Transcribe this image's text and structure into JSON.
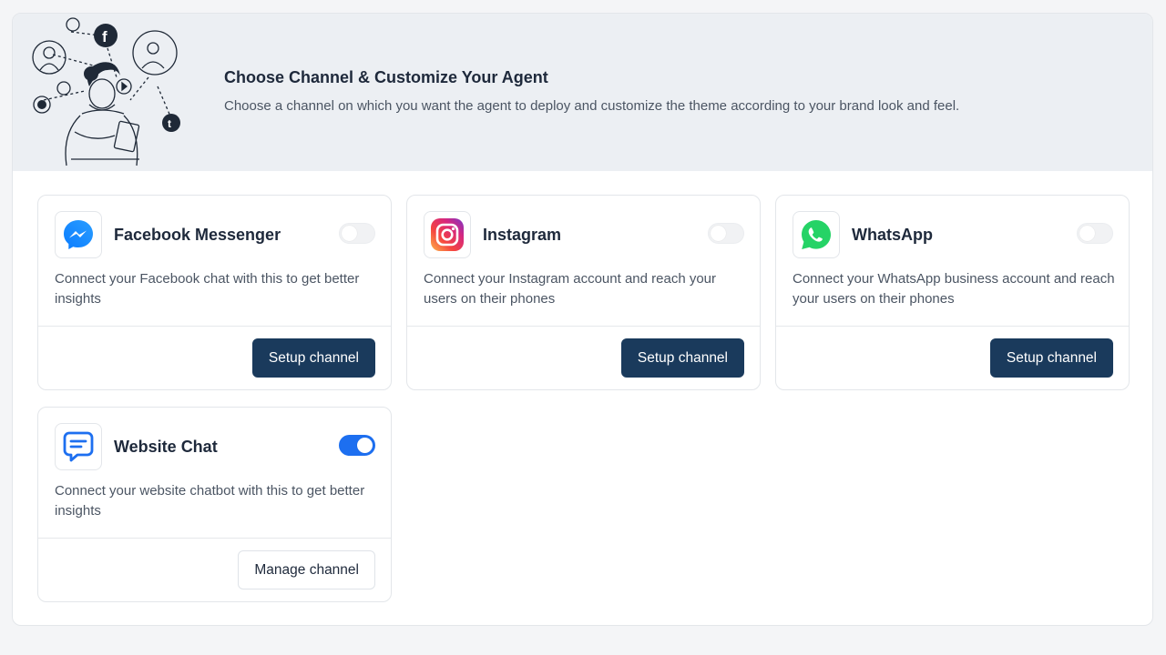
{
  "header": {
    "title": "Choose Channel & Customize Your Agent",
    "subtitle": "Choose a channel on which you want the agent to deploy and customize the theme according to your brand look and feel."
  },
  "colors": {
    "primary_button": "#1a3a5c",
    "toggle_on": "#1d6ff0",
    "banner_bg": "#eceff3"
  },
  "channels": [
    {
      "name": "Facebook Messenger",
      "icon": "messenger-icon",
      "description": "Connect your Facebook chat with this to get better insights",
      "enabled": false,
      "action_label": "Setup channel"
    },
    {
      "name": "Instagram",
      "icon": "instagram-icon",
      "description": "Connect your Instagram account and reach your users on their phones",
      "enabled": false,
      "action_label": "Setup channel"
    },
    {
      "name": "WhatsApp",
      "icon": "whatsapp-icon",
      "description": "Connect your WhatsApp business account and reach your users on their phones",
      "enabled": false,
      "action_label": "Setup channel"
    },
    {
      "name": "Website Chat",
      "icon": "chat-bubble-icon",
      "description": "Connect your website chatbot with this to get better insights",
      "enabled": true,
      "action_label": "Manage channel"
    }
  ]
}
